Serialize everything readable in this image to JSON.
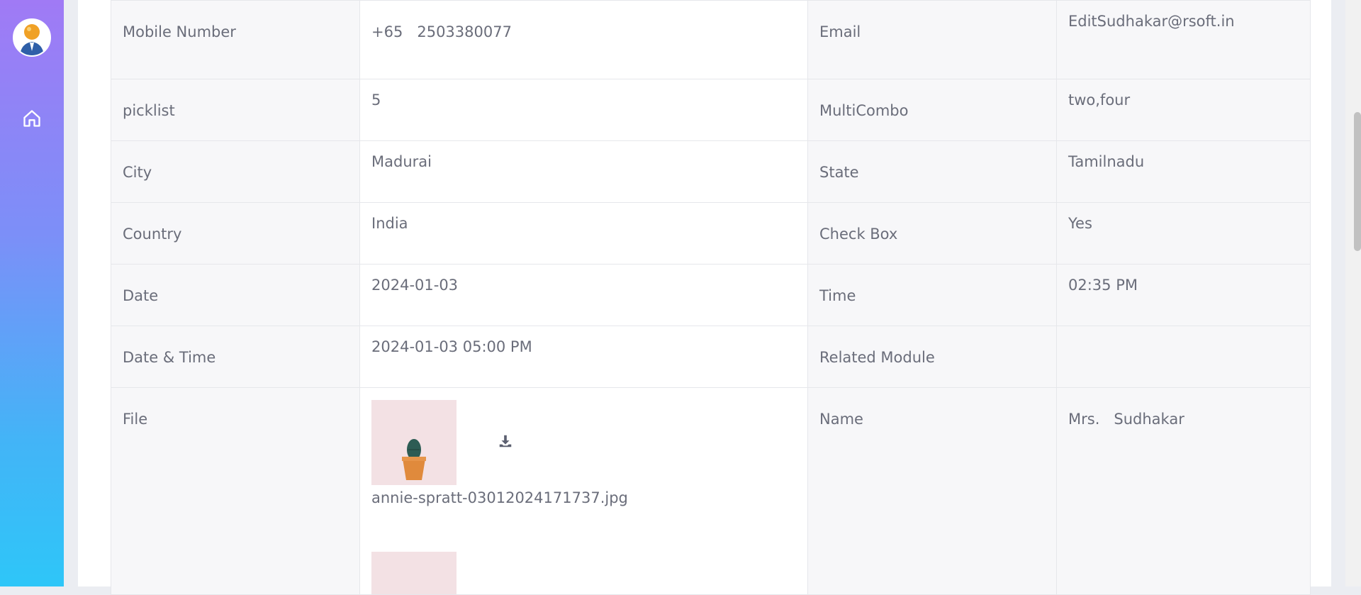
{
  "sidebar": {
    "avatar_icon": "user-avatar-icon",
    "home_icon": "home-icon"
  },
  "record": {
    "rows": [
      {
        "label1": "Mobile Number",
        "value1": "+65   2503380077",
        "label2": "Email",
        "value2": "EditSudhakar@rsoft.in"
      },
      {
        "label1": "picklist",
        "value1": "5",
        "label2": "MultiCombo",
        "value2": "two,four"
      },
      {
        "label1": "City",
        "value1": "Madurai",
        "label2": "State",
        "value2": "Tamilnadu"
      },
      {
        "label1": "Country",
        "value1": "India",
        "label2": "Check Box",
        "value2": "Yes"
      },
      {
        "label1": "Date",
        "value1": "2024-01-03",
        "label2": "Time",
        "value2": "02:35 PM"
      },
      {
        "label1": "Date & Time",
        "value1": "2024-01-03 05:00 PM",
        "label2": "Related Module",
        "value2": ""
      }
    ],
    "file_row": {
      "label": "File",
      "file_name": "annie-spratt-03012024171737.jpg",
      "download_icon": "download-icon",
      "name_label": "Name",
      "name_value": "Mrs.   Sudhakar"
    }
  },
  "colors": {
    "sidebar_top": "#a07af5",
    "sidebar_bottom": "#2ec6f8",
    "label_bg": "#f7f7f9",
    "text": "#6a6d7a"
  }
}
